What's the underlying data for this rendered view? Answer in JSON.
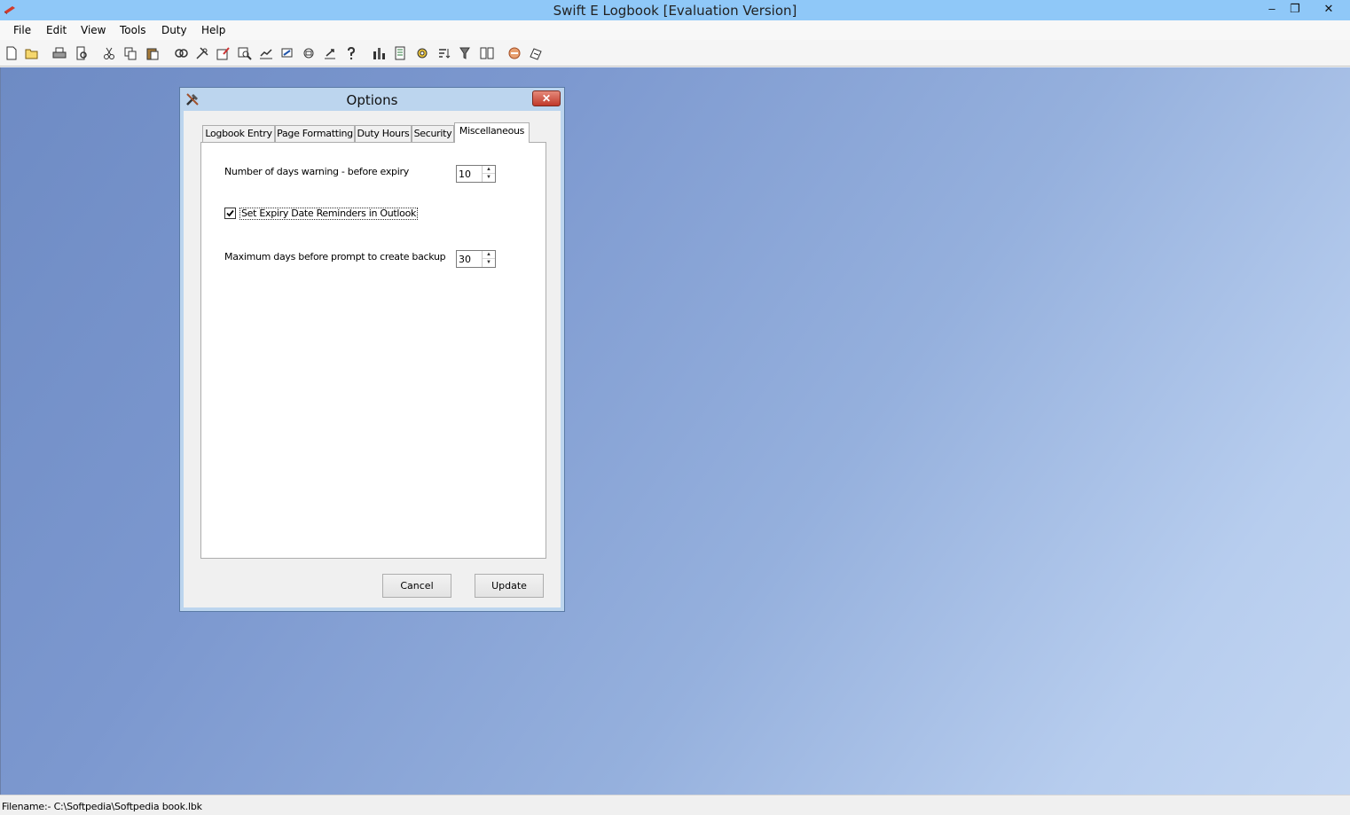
{
  "window": {
    "title": "Swift E Logbook [Evaluation Version]",
    "minimize_glyph": "–",
    "maximize_glyph": "❐",
    "close_glyph": "✕"
  },
  "menu": {
    "file": "File",
    "edit": "Edit",
    "view": "View",
    "tools": "Tools",
    "duty": "Duty",
    "help": "Help"
  },
  "toolbar": {
    "icons": [
      "new-icon",
      "open-icon",
      "print-icon",
      "print-preview-icon",
      "cut-icon",
      "copy-icon",
      "paste-icon",
      "find-icon",
      "tools-icon",
      "edit-entry-icon",
      "search-icon",
      "chart-icon",
      "network-icon",
      "cloud-icon",
      "upload-icon",
      "help-icon",
      "bar-chart-icon",
      "report-icon",
      "settings-icon",
      "sort-icon",
      "filter-icon",
      "columns-icon",
      "logo-icon",
      "calculator-icon"
    ]
  },
  "dialog": {
    "title": "Options",
    "close_glyph": "✕",
    "tabs": {
      "logbook_entry": "Logbook Entry",
      "page_formatting": "Page Formatting",
      "duty_hours": "Duty Hours",
      "security": "Security",
      "miscellaneous": "Miscellaneous"
    },
    "active_tab": "Miscellaneous",
    "expiry_warning_label": "Number of days warning -  before expiry",
    "expiry_warning_value": "10",
    "outlook_reminder_label": "Set Expiry Date Reminders in Outlook",
    "outlook_reminder_checked": true,
    "backup_prompt_label": "Maximum days before prompt to create backup",
    "backup_prompt_value": "30",
    "cancel_label": "Cancel",
    "update_label": "Update"
  },
  "statusbar": {
    "filename": "Filename:- C:\\Softpedia\\Softpedia book.lbk"
  }
}
